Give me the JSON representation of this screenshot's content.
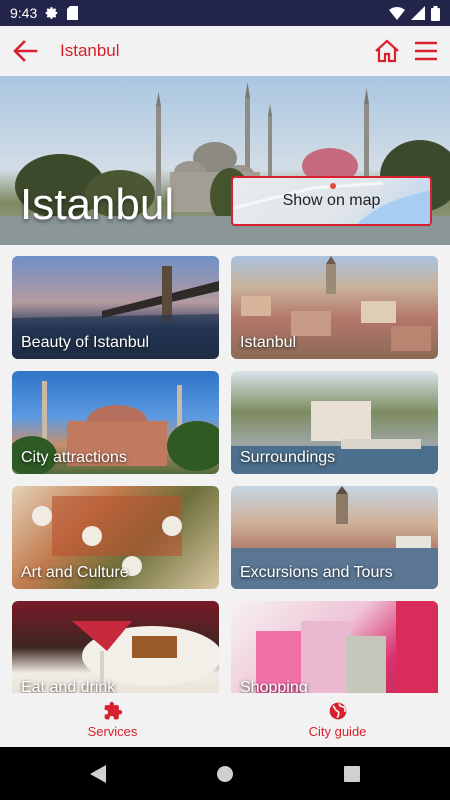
{
  "status_bar": {
    "time": "9:43"
  },
  "app_bar": {
    "title": "Istanbul"
  },
  "hero": {
    "title": "Istanbul",
    "map_button": "Show on map"
  },
  "tiles": [
    {
      "label": "Beauty of Istanbul"
    },
    {
      "label": "Istanbul"
    },
    {
      "label": "City attractions"
    },
    {
      "label": "Surroundings"
    },
    {
      "label": "Art and Culture"
    },
    {
      "label": "Excursions and Tours"
    },
    {
      "label": "Eat and drink"
    },
    {
      "label": "Shopping"
    }
  ],
  "bottom_nav": [
    {
      "label": "Services",
      "icon": "puzzle-icon"
    },
    {
      "label": "City guide",
      "icon": "globe-icon"
    }
  ],
  "colors": {
    "accent": "#d8202e",
    "status_bar": "#23244a"
  }
}
